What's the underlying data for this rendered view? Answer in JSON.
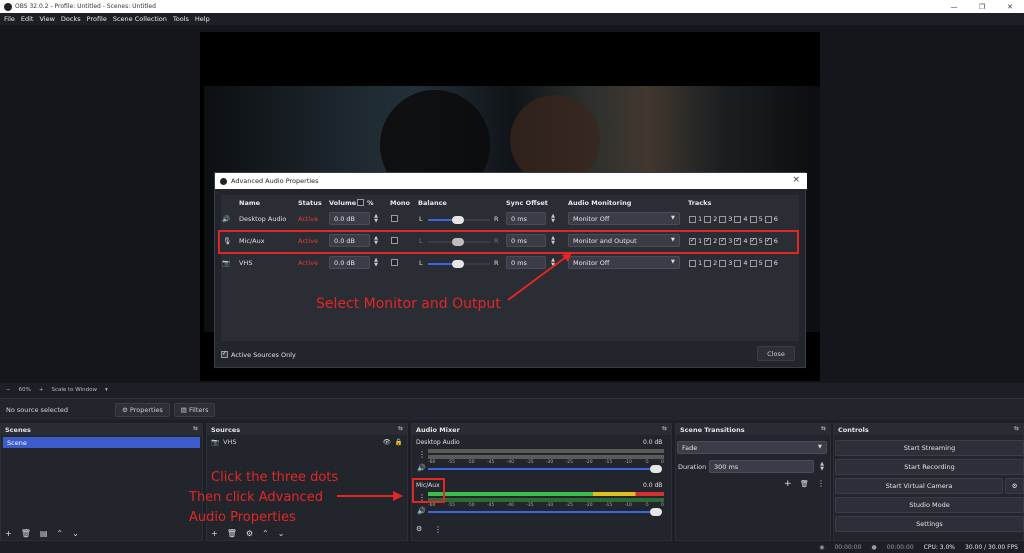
{
  "window": {
    "title": "OBS 32.0.2 - Profile: Untitled - Scenes: Untitled",
    "controls": [
      "—",
      "❐",
      "✕"
    ]
  },
  "menu": [
    "File",
    "Edit",
    "View",
    "Docks",
    "Profile",
    "Scene Collection",
    "Tools",
    "Help"
  ],
  "zoom": {
    "minus": "−",
    "value": "60%",
    "plus": "+",
    "scale": "Scale to Window",
    "dropdown": "▾"
  },
  "source_bar": {
    "selected": "No source selected",
    "properties": "Properties",
    "filters": "Filters"
  },
  "dialog": {
    "title": "Advanced Audio Properties",
    "headers": {
      "name": "Name",
      "status": "Status",
      "volume": "Volume",
      "percent": "%",
      "mono": "Mono",
      "balance": "Balance",
      "sync": "Sync Offset",
      "monitoring": "Audio Monitoring",
      "tracks": "Tracks"
    },
    "rows": [
      {
        "name": "Desktop Audio",
        "status": "Active",
        "volume": "0.0 dB",
        "bal_l": "L",
        "bal_r": "R",
        "sync": "0 ms",
        "monitoring": "Monitor Off",
        "tracks": [
          false,
          false,
          false,
          false,
          false,
          false
        ]
      },
      {
        "name": "Mic/Aux",
        "status": "Active",
        "volume": "0.0 dB",
        "bal_l": "L",
        "bal_r": "R",
        "sync": "0 ms",
        "monitoring": "Monitor and Output",
        "tracks": [
          true,
          true,
          true,
          true,
          true,
          true
        ]
      },
      {
        "name": "VHS",
        "status": "Active",
        "volume": "0.0 dB",
        "bal_l": "L",
        "bal_r": "R",
        "sync": "0 ms",
        "monitoring": "Monitor Off",
        "tracks": [
          false,
          false,
          false,
          false,
          false,
          false
        ]
      }
    ],
    "track_labels": [
      "1",
      "2",
      "3",
      "4",
      "5",
      "6"
    ],
    "active_only": "Active Sources Only",
    "close": "Close"
  },
  "annotations": {
    "select": "Select Monitor and Output",
    "click1": "Click the three dots",
    "click2": "Then click Advanced",
    "click3": "Audio Properties"
  },
  "scenes": {
    "title": "Scenes",
    "items": [
      "Scene"
    ]
  },
  "sources": {
    "title": "Sources",
    "items": [
      "VHS"
    ]
  },
  "mixer": {
    "title": "Audio Mixer",
    "channels": [
      {
        "name": "Desktop Audio",
        "db": "0.0 dB"
      },
      {
        "name": "Mic/Aux",
        "db": "0.0 dB"
      }
    ],
    "scale": [
      "-60",
      "-55",
      "-50",
      "-45",
      "-40",
      "-35",
      "-30",
      "-25",
      "-20",
      "-15",
      "-10",
      "-5",
      "0"
    ]
  },
  "transitions": {
    "title": "Scene Transitions",
    "type": "Fade",
    "duration_label": "Duration",
    "duration": "300 ms"
  },
  "controls": {
    "title": "Controls",
    "buttons": [
      "Start Streaming",
      "Start Recording",
      "Start Virtual Camera",
      "Studio Mode",
      "Settings"
    ]
  },
  "status": {
    "stream_time": "00:00:00",
    "rec_time": "00:00:00",
    "cpu": "CPU: 3.0%",
    "fps": "30.00 / 30.00 FPS"
  }
}
